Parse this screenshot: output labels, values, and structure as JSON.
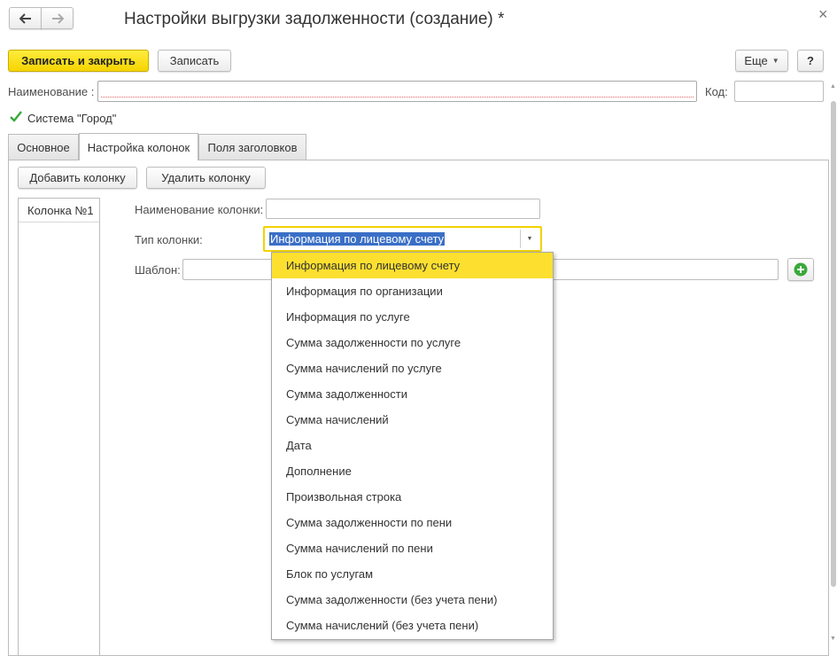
{
  "window": {
    "title": "Настройки выгрузки задолженности (создание) *",
    "back_icon": "arrow-left-icon",
    "forward_icon": "arrow-right-icon",
    "close_glyph": "×"
  },
  "toolbar": {
    "save_close_label": "Записать и закрыть",
    "save_label": "Записать",
    "more_label": "Еще",
    "help_label": "?"
  },
  "form": {
    "name_label": "Наименование :",
    "name_value": "",
    "code_label": "Код:",
    "code_value": "",
    "system_checkbox_label": "Система \"Город\"",
    "system_checked": true
  },
  "tabs": [
    {
      "label": "Основное",
      "active": false
    },
    {
      "label": "Настройка колонок",
      "active": true
    },
    {
      "label": "Поля заголовков",
      "active": false
    }
  ],
  "columns_panel": {
    "add_button": "Добавить колонку",
    "delete_button": "Удалить колонку",
    "columns": [
      "Колонка №1"
    ],
    "column_name_label": "Наименование колонки:",
    "column_name_value": "",
    "column_type_label": "Тип колонки:",
    "column_type_value": "Информация по лицевому счету",
    "template_label": "Шаблон:",
    "template_value": ""
  },
  "dropdown": {
    "options": [
      "Информация по лицевому счету",
      "Информация по организации",
      "Информация по услуге",
      "Сумма задолженности по услуге",
      "Сумма начислений по услуге",
      "Сумма задолженности",
      "Сумма начислений",
      "Дата",
      "Дополнение",
      "Произвольная строка",
      "Сумма задолженности по пени",
      "Сумма начислений по пени",
      "Блок по услугам",
      "Сумма задолженности (без учета пени)",
      "Сумма начислений (без учета пени)"
    ],
    "selected_index": 0
  },
  "colors": {
    "accent_yellow": "#f6d400",
    "selection_blue": "#3a6fc6",
    "add_green": "#3aa93a"
  }
}
